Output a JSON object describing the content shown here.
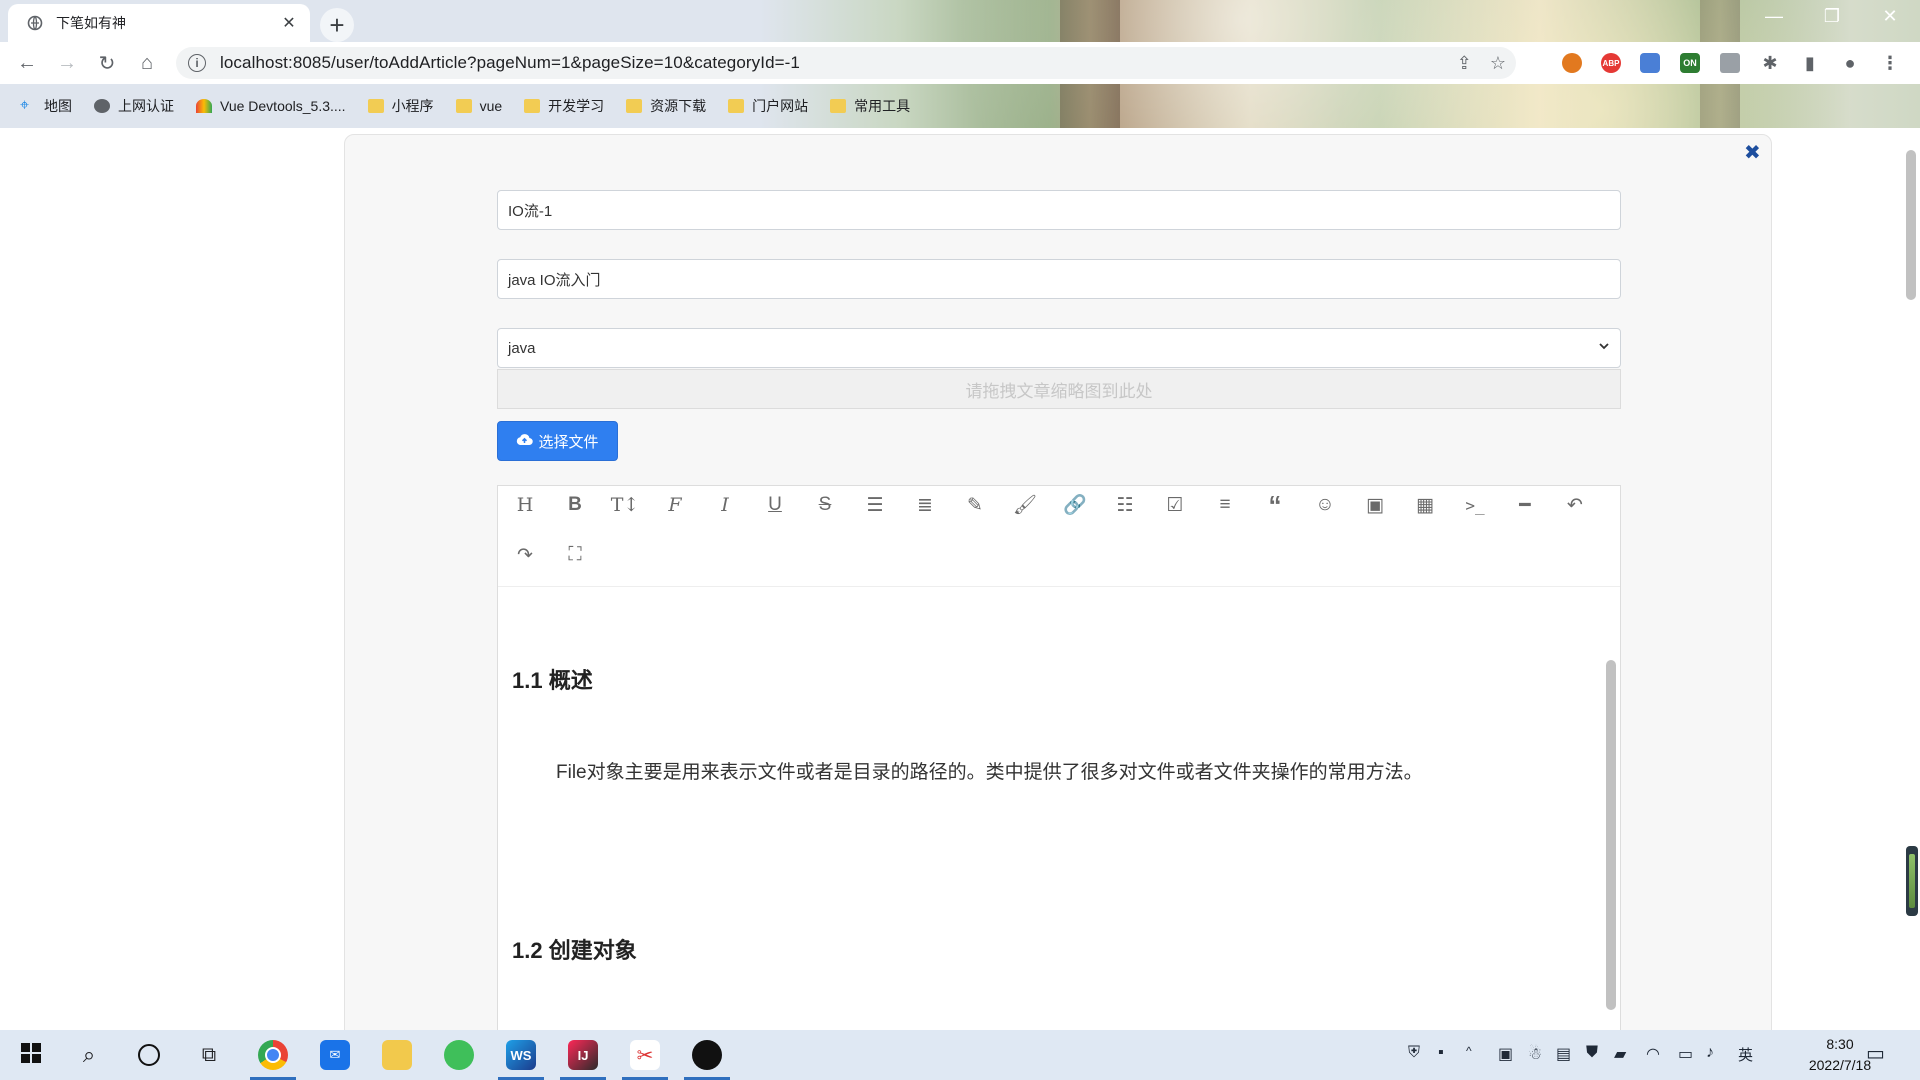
{
  "browser": {
    "tab_title": "下笔如有神",
    "url": "localhost:8085/user/toAddArticle?pageNum=1&pageSize=10&categoryId=-1",
    "ext_abp_label": "ABP",
    "ext_on_label": "ON",
    "bookmarks": [
      {
        "label": "地图",
        "icon": "map-pin-icon"
      },
      {
        "label": "上网认证",
        "icon": "globe-icon"
      },
      {
        "label": "Vue Devtools_5.3....",
        "icon": "vue-devtools-icon"
      },
      {
        "label": "小程序",
        "icon": "folder-icon"
      },
      {
        "label": "vue",
        "icon": "folder-icon"
      },
      {
        "label": "开发学习",
        "icon": "folder-icon"
      },
      {
        "label": "资源下载",
        "icon": "folder-icon"
      },
      {
        "label": "门户网站",
        "icon": "folder-icon"
      },
      {
        "label": "常用工具",
        "icon": "folder-icon"
      }
    ]
  },
  "form": {
    "title_value": "IO流-1",
    "summary_value": "java IO流入门",
    "category_selected": "java",
    "dropzone_text": "请拖拽文章缩略图到此处",
    "choose_file_label": "选择文件"
  },
  "editor": {
    "toolbar": [
      "heading",
      "bold",
      "font-size",
      "font-family",
      "italic",
      "underline",
      "strikethrough",
      "indent",
      "line-height",
      "highlighter",
      "brush",
      "link",
      "bullet-list",
      "checkbox",
      "align-left",
      "quote",
      "emoji",
      "image",
      "table",
      "code",
      "horizontal-rule",
      "undo",
      "redo",
      "fullscreen"
    ],
    "content": [
      {
        "type": "h2",
        "text": "1.1 概述"
      },
      {
        "type": "p",
        "text": "File对象主要是用来表示文件或者是目录的路径的。类中提供了很多对文件或者文件夹操作的常用方法。"
      },
      {
        "type": "h2",
        "text": "1.2 创建对象"
      }
    ]
  },
  "taskbar": {
    "apps": [
      "windows-start",
      "search",
      "cortana",
      "task-view",
      "chrome",
      "mail",
      "file-explorer",
      "browser-green",
      "webstorm",
      "intellij",
      "snipping-tool",
      "obs"
    ],
    "ime": "英",
    "time": "8:30",
    "date": "2022/7/18"
  },
  "colors": {
    "primary_button": "#2f7ff0",
    "close_icon": "#1d4e9e"
  }
}
